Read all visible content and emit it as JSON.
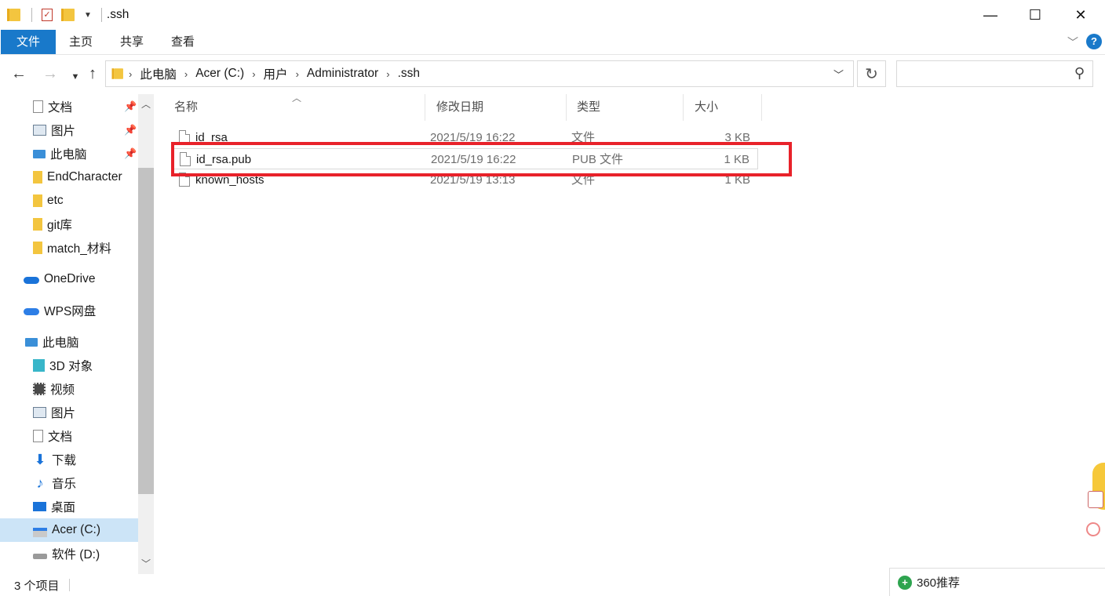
{
  "window": {
    "title": ".ssh",
    "controls": [
      "—",
      "☐",
      "✕"
    ]
  },
  "ribbon": {
    "tabs": [
      "文件",
      "主页",
      "共享",
      "查看"
    ]
  },
  "address": {
    "breadcrumbs": [
      "此电脑",
      "Acer (C:)",
      "用户",
      "Administrator",
      ".ssh"
    ],
    "search_placeholder": ""
  },
  "sidebar": {
    "quick_access": [
      {
        "label": "文档",
        "icon": "document-icon",
        "pinned": true
      },
      {
        "label": "图片",
        "icon": "pictures-icon",
        "pinned": true
      },
      {
        "label": "此电脑",
        "icon": "computer-icon",
        "pinned": true
      },
      {
        "label": "EndCharacter",
        "icon": "folder-icon",
        "pinned": false
      },
      {
        "label": "etc",
        "icon": "folder-icon",
        "pinned": false
      },
      {
        "label": "git库",
        "icon": "folder-icon",
        "pinned": false
      },
      {
        "label": "match_材料",
        "icon": "folder-icon",
        "pinned": false
      }
    ],
    "onedrive": "OneDrive",
    "wps": "WPS网盘",
    "this_pc": "此电脑",
    "pc_items": [
      {
        "label": "3D 对象",
        "icon": "3d-objects-icon"
      },
      {
        "label": "视频",
        "icon": "videos-icon"
      },
      {
        "label": "图片",
        "icon": "pictures-icon"
      },
      {
        "label": "文档",
        "icon": "document-icon"
      },
      {
        "label": "下载",
        "icon": "download-icon"
      },
      {
        "label": "音乐",
        "icon": "music-icon"
      },
      {
        "label": "桌面",
        "icon": "desktop-icon"
      },
      {
        "label": "Acer (C:)",
        "icon": "drive-c-icon",
        "selected": true
      },
      {
        "label": "软件 (D:)",
        "icon": "drive-d-icon"
      }
    ]
  },
  "columns": {
    "name": "名称",
    "date": "修改日期",
    "type": "类型",
    "size": "大小"
  },
  "files": [
    {
      "name": "id_rsa",
      "date": "2021/5/19 16:22",
      "type": "文件",
      "size": "3 KB"
    },
    {
      "name": "id_rsa.pub",
      "date": "2021/5/19 16:22",
      "type": "PUB 文件",
      "size": "1 KB"
    },
    {
      "name": "known_hosts",
      "date": "2021/5/19 13:13",
      "type": "文件",
      "size": "1 KB"
    }
  ],
  "status": {
    "item_count": "3 个项目"
  },
  "recommend": {
    "label": "360推荐"
  },
  "colors": {
    "accent": "#1979ca",
    "highlight": "#e8222a",
    "selected": "#cce4f7"
  }
}
